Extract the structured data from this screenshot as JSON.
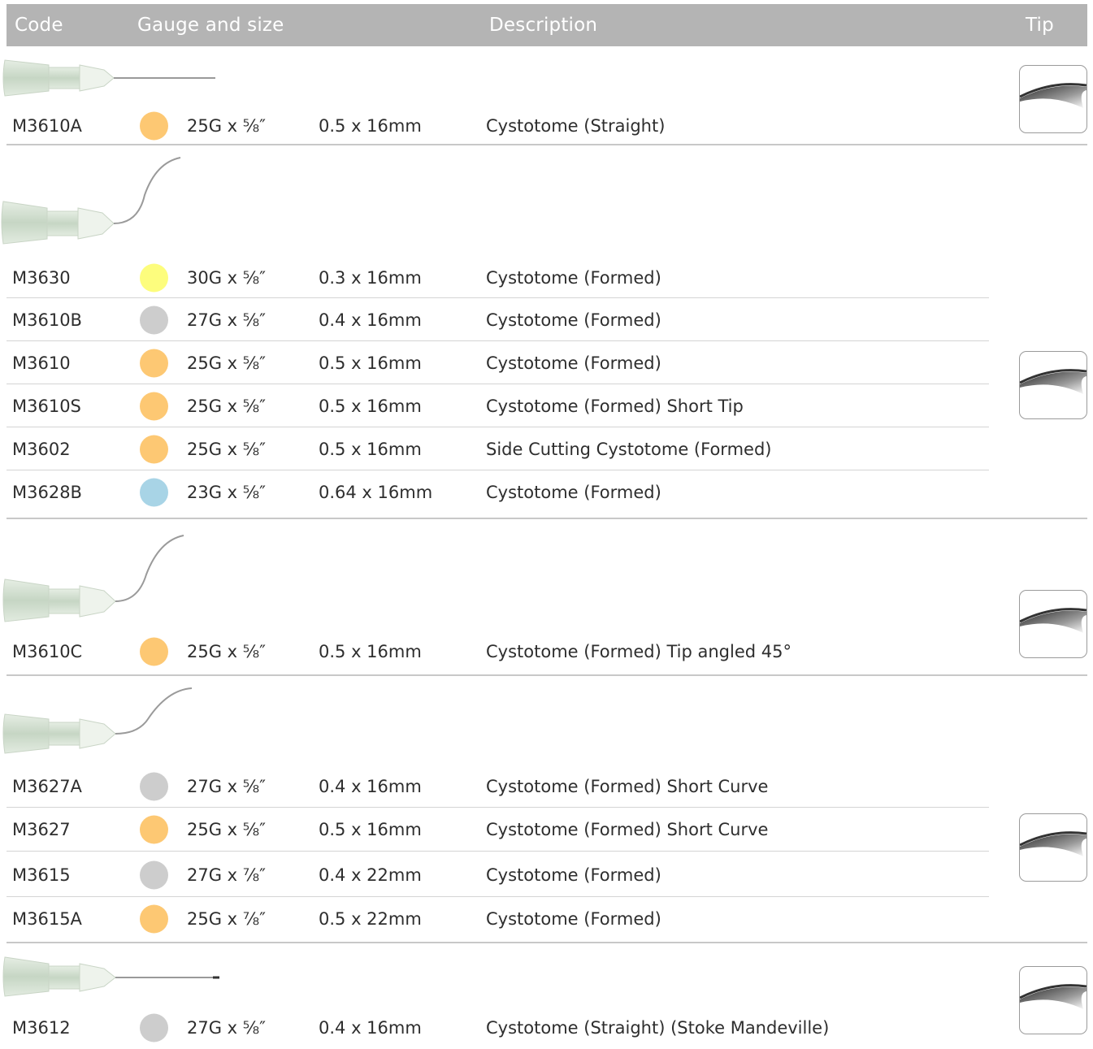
{
  "header": {
    "code": "Code",
    "gauge": "Gauge and size",
    "description": "Description",
    "tip": "Tip"
  },
  "colors": {
    "orange": "#fdc873",
    "yellow": "#fdfd7d",
    "grey": "#cdcdcd",
    "blue": "#a8d4e6",
    "header_bg": "#b4b4b4"
  },
  "groups": [
    {
      "needle": "straight-needle-icon",
      "rows": [
        {
          "code": "M3610A",
          "color": "orange",
          "gauge": "25G x",
          "inch": "⅝″",
          "size": "0.5 x 16mm",
          "desc": "Cystotome (Straight)"
        }
      ]
    },
    {
      "needle": "formed-needle-icon",
      "rows": [
        {
          "code": "M3630",
          "color": "yellow",
          "gauge": "30G x",
          "inch": "⅝″",
          "size": "0.3 x 16mm",
          "desc": "Cystotome (Formed)"
        },
        {
          "code": "M3610B",
          "color": "grey",
          "gauge": "27G x",
          "inch": "⅝″",
          "size": "0.4 x 16mm",
          "desc": "Cystotome (Formed)"
        },
        {
          "code": "M3610",
          "color": "orange",
          "gauge": "25G x",
          "inch": "⅝″",
          "size": "0.5 x 16mm",
          "desc": "Cystotome (Formed)"
        },
        {
          "code": "M3610S",
          "color": "orange",
          "gauge": "25G x",
          "inch": "⅝″",
          "size": "0.5 x 16mm",
          "desc": "Cystotome (Formed) Short Tip"
        },
        {
          "code": "M3602",
          "color": "orange",
          "gauge": "25G x",
          "inch": "⅝″",
          "size": "0.5 x 16mm",
          "desc": "Side Cutting Cystotome (Formed)"
        },
        {
          "code": "M3628B",
          "color": "blue",
          "gauge": "23G x",
          "inch": "⅝″",
          "size": "0.64 x 16mm",
          "desc": "Cystotome (Formed)"
        }
      ]
    },
    {
      "needle": "angled-needle-icon",
      "rows": [
        {
          "code": "M3610C",
          "color": "orange",
          "gauge": "25G x",
          "inch": "⅝″",
          "size": "0.5 x 16mm",
          "desc": "Cystotome (Formed) Tip angled 45°"
        }
      ]
    },
    {
      "needle": "short-curve-needle-icon",
      "rows": [
        {
          "code": "M3627A",
          "color": "grey",
          "gauge": "27G x",
          "inch": "⅝″",
          "size": "0.4 x 16mm",
          "desc": "Cystotome (Formed) Short Curve"
        },
        {
          "code": "M3627",
          "color": "orange",
          "gauge": "25G x",
          "inch": "⅝″",
          "size": "0.5 x 16mm",
          "desc": "Cystotome (Formed) Short Curve"
        },
        {
          "code": "M3615",
          "color": "grey",
          "gauge": "27G x",
          "inch": "⅞″",
          "size": "0.4 x 22mm",
          "desc": "Cystotome (Formed)"
        },
        {
          "code": "M3615A",
          "color": "orange",
          "gauge": "25G x",
          "inch": "⅞″",
          "size": "0.5 x 22mm",
          "desc": "Cystotome (Formed)"
        }
      ]
    },
    {
      "needle": "straight-needle-icon",
      "rows": [
        {
          "code": "M3612",
          "color": "grey",
          "gauge": "27G x",
          "inch": "⅝″",
          "size": "0.4 x 16mm",
          "desc": "Cystotome (Straight) (Stoke Mandeville)"
        }
      ]
    }
  ]
}
